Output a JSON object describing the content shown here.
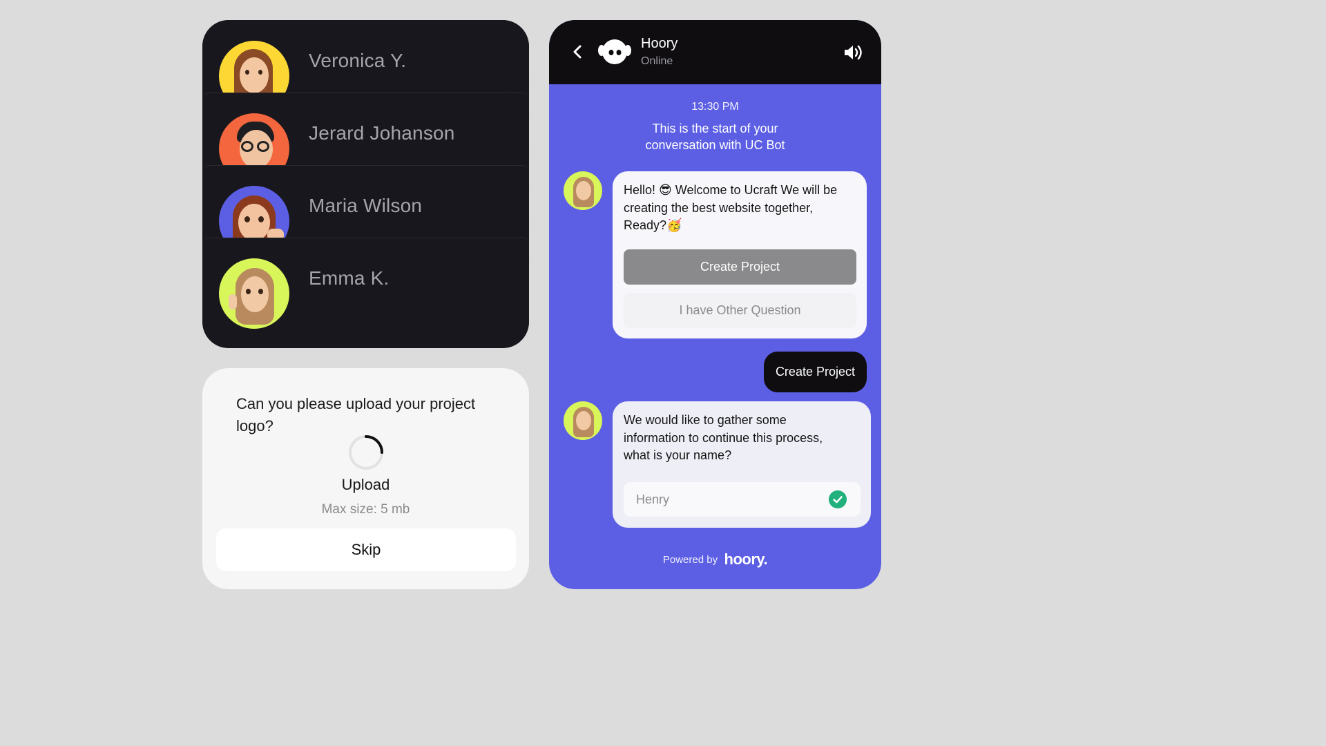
{
  "contacts": {
    "items": [
      {
        "name": "Veronica Y.",
        "avatar_bg": "#fdd835",
        "icon": "memoji-woman-brown-hair"
      },
      {
        "name": "Jerard Johanson",
        "avatar_bg": "#f4663d",
        "icon": "memoji-man-glasses"
      },
      {
        "name": "Maria Wilson",
        "avatar_bg": "#5c5fe4",
        "icon": "memoji-woman-waving"
      },
      {
        "name": "Emma K.",
        "avatar_bg": "#d8f55a",
        "icon": "memoji-woman-blonde"
      }
    ]
  },
  "upload": {
    "question": "Can you please upload your project logo?",
    "label": "Upload",
    "max_size": "Max size: 5 mb",
    "skip_label": "Skip",
    "spinner_icon": "loading-spinner"
  },
  "chat": {
    "header": {
      "bot_name": "Hoory",
      "status": "Online",
      "back_icon": "chevron-left",
      "sound_icon": "speaker-volume"
    },
    "time": "13:30 PM",
    "intro": "This is the start of your conversation with UC Bot",
    "messages": [
      {
        "from": "bot",
        "text": "Hello! 😎 Welcome to Ucraft We will be creating the best website together, Ready?🥳",
        "buttons": [
          "Create Project",
          "I have Other Question"
        ]
      },
      {
        "from": "user",
        "text": "Create Project"
      },
      {
        "from": "bot",
        "text": "We would like to gather some information to continue this process, what is your name?",
        "input_value": "Henry",
        "input_valid": true
      }
    ],
    "powered_by": "Powered by",
    "brand": "hoory.",
    "colors": {
      "accent": "#5c5fe4",
      "header_bg": "#0f0d10",
      "success": "#22b07d"
    }
  }
}
